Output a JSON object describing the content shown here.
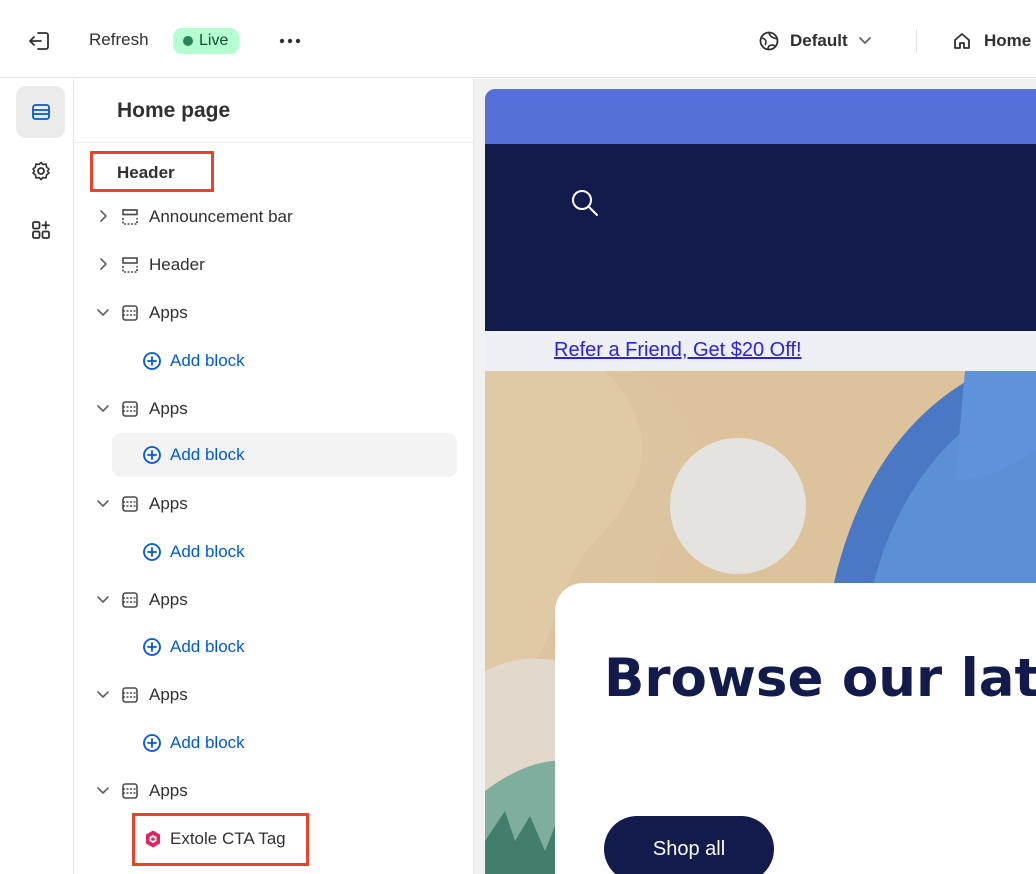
{
  "topbar": {
    "refresh_label": "Refresh",
    "status_label": "Live",
    "theme_label": "Default",
    "page_label": "Home"
  },
  "sidebar": {
    "title": "Home page",
    "group_label": "Header",
    "sections": [
      {
        "label": "Announcement bar",
        "expanded": false
      },
      {
        "label": "Header",
        "expanded": false
      },
      {
        "label": "Apps",
        "expanded": true,
        "child": "Add block"
      },
      {
        "label": "Apps",
        "expanded": true,
        "child": "Add block"
      },
      {
        "label": "Apps",
        "expanded": true,
        "child": "Add block"
      },
      {
        "label": "Apps",
        "expanded": true,
        "child": "Add block"
      },
      {
        "label": "Apps",
        "expanded": true,
        "child": "Add block"
      },
      {
        "label": "Apps",
        "expanded": true,
        "child": "Extole CTA Tag"
      }
    ]
  },
  "preview": {
    "refer_link": "Refer a Friend, Get $20 Off!",
    "hero_title": "Browse our latest products",
    "hero_button": "Shop all"
  },
  "colors": {
    "accent": "#005bd3",
    "live_bg": "#b4fed2",
    "highlight": "#e8432d",
    "store_navy": "#131a4c",
    "store_blue": "#5470d8"
  },
  "icons": [
    "exit-icon",
    "more-icon",
    "globe-icon",
    "chevron-down-icon",
    "home-icon",
    "sections-icon",
    "gear-icon",
    "apps-icon",
    "chevron-right-icon",
    "section-icon",
    "plus-circle-icon",
    "extole-logo-icon",
    "search-icon"
  ]
}
